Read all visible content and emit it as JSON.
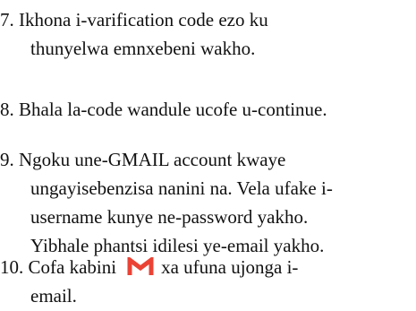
{
  "steps": [
    {
      "number": "7.",
      "lines": [
        "Ikhona i-varification code ezo ku",
        "thunyelwa emnxebeni wakho."
      ]
    },
    {
      "number": "8.",
      "lines": [
        "Bhala la-code wandule ucofe u-continue."
      ]
    },
    {
      "number": "9.",
      "lines": [
        "Ngoku une-GMAIL account kwaye",
        "ungayisebenzisa nanini na. Vela ufake i-",
        "username kunye ne-password yakho.",
        "Yibhale phantsi idilesi ye-email yakho."
      ]
    },
    {
      "number": "10.",
      "before_icon": "Cofa kabini",
      "after_icon": "xa ufuna ujonga i-",
      "line2": "email.",
      "icon": "gmail-icon",
      "icon_color": "#EA4335"
    }
  ]
}
